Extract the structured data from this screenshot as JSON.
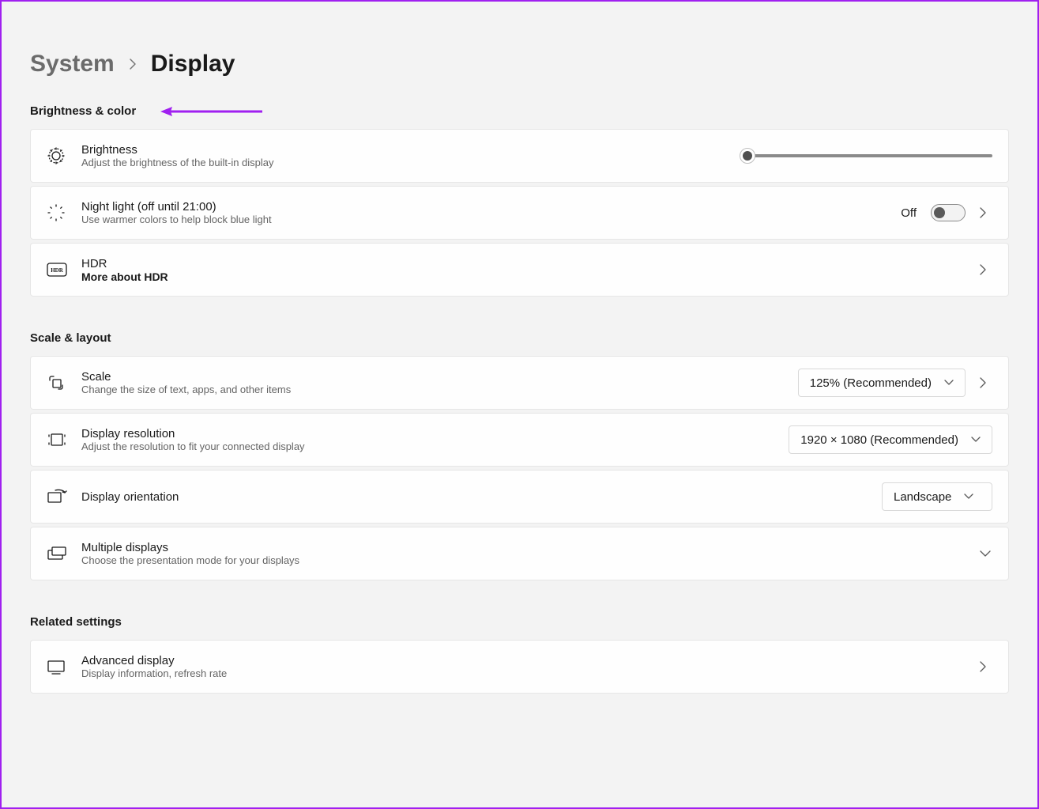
{
  "breadcrumb": {
    "parent": "System",
    "current": "Display"
  },
  "sections": {
    "brightness_color": {
      "title": "Brightness & color",
      "brightness": {
        "title": "Brightness",
        "sub": "Adjust the brightness of the built-in display"
      },
      "night_light": {
        "title": "Night light (off until 21:00)",
        "sub": "Use warmer colors to help block blue light",
        "state_label": "Off"
      },
      "hdr": {
        "title": "HDR",
        "link": "More about HDR"
      }
    },
    "scale_layout": {
      "title": "Scale & layout",
      "scale": {
        "title": "Scale",
        "sub": "Change the size of text, apps, and other items",
        "value": "125% (Recommended)"
      },
      "resolution": {
        "title": "Display resolution",
        "sub": "Adjust the resolution to fit your connected display",
        "value": "1920 × 1080 (Recommended)"
      },
      "orientation": {
        "title": "Display orientation",
        "value": "Landscape"
      },
      "multiple": {
        "title": "Multiple displays",
        "sub": "Choose the presentation mode for your displays"
      }
    },
    "related": {
      "title": "Related settings",
      "advanced": {
        "title": "Advanced display",
        "sub": "Display information, refresh rate"
      }
    }
  },
  "colors": {
    "annotation": "#a020f0"
  }
}
